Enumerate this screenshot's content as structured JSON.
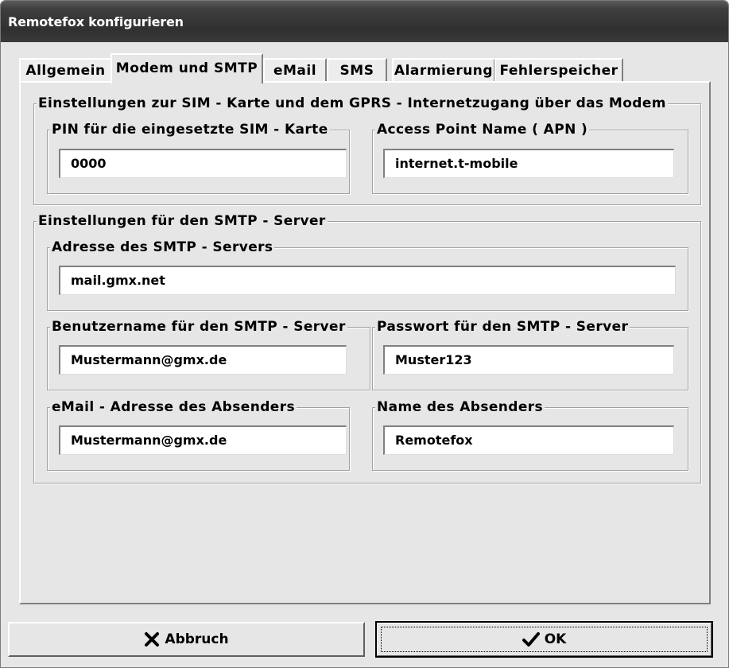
{
  "window": {
    "title": "Remotefox konfigurieren"
  },
  "tabs": [
    "Allgemein",
    "Modem und SMTP",
    "eMail",
    "SMS",
    "Alarmierung",
    "Fehlerspeicher"
  ],
  "active_tab": "Modem und SMTP",
  "modem_group": {
    "legend": "Einstellungen zur SIM - Karte und dem GPRS - Internetzugang über das Modem",
    "pin": {
      "label": "PIN für die eingesetzte SIM - Karte",
      "value": "0000"
    },
    "apn": {
      "label": "Access Point Name ( APN )",
      "value": "internet.t-mobile"
    }
  },
  "smtp_group": {
    "legend": "Einstellungen für den SMTP - Server",
    "server": {
      "label": "Adresse des SMTP - Servers",
      "value": "mail.gmx.net"
    },
    "username": {
      "label": "Benutzername für den SMTP - Server",
      "value": "Mustermann@gmx.de"
    },
    "password": {
      "label": "Passwort für den SMTP - Server",
      "value": "Muster123"
    },
    "sender_email": {
      "label": "eMail - Adresse des Absenders",
      "value": "Mustermann@gmx.de"
    },
    "sender_name": {
      "label": "Name des Absenders",
      "value": "Remotefox"
    }
  },
  "buttons": {
    "cancel": {
      "label": "Abbruch",
      "icon": "x-icon"
    },
    "ok": {
      "label": "OK",
      "icon": "checkmark-icon"
    }
  },
  "colors": {
    "titlebar": "#3a3a3a",
    "dialog_background": "#e6e6e6"
  }
}
